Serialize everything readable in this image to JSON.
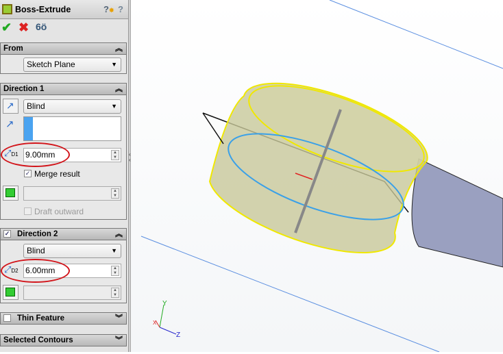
{
  "panel": {
    "title": "Boss-Extrude",
    "help_icons": [
      "whats-wrong-icon",
      "help-icon"
    ],
    "actions": [
      "ok-check-icon",
      "cancel-x-icon",
      "detailed-preview-icon"
    ],
    "from": {
      "header": "From",
      "start": "Sketch Plane"
    },
    "direction1": {
      "header": "Direction 1",
      "end_condition": "Blind",
      "depth": "9.00mm",
      "depth_label": "D1",
      "merge_result_label": "Merge result",
      "merge_result": true,
      "draft_outward_label": "Draft outward",
      "draft_outward": false
    },
    "direction2": {
      "header": "Direction 2",
      "enabled": true,
      "end_condition": "Blind",
      "depth": "6.00mm",
      "depth_label": "D2"
    },
    "thin_feature": {
      "header": "Thin Feature",
      "enabled": false
    },
    "selected_contours": {
      "header": "Selected Contours"
    }
  },
  "viewport": {
    "triad": {
      "x": "X",
      "y": "Y",
      "z": "Z"
    }
  },
  "colors": {
    "highlight_oval": "#d2141a",
    "preview": "#c8c89a",
    "edge_yellow": "#f0e800",
    "sketch_blue": "#3aa0e8"
  }
}
